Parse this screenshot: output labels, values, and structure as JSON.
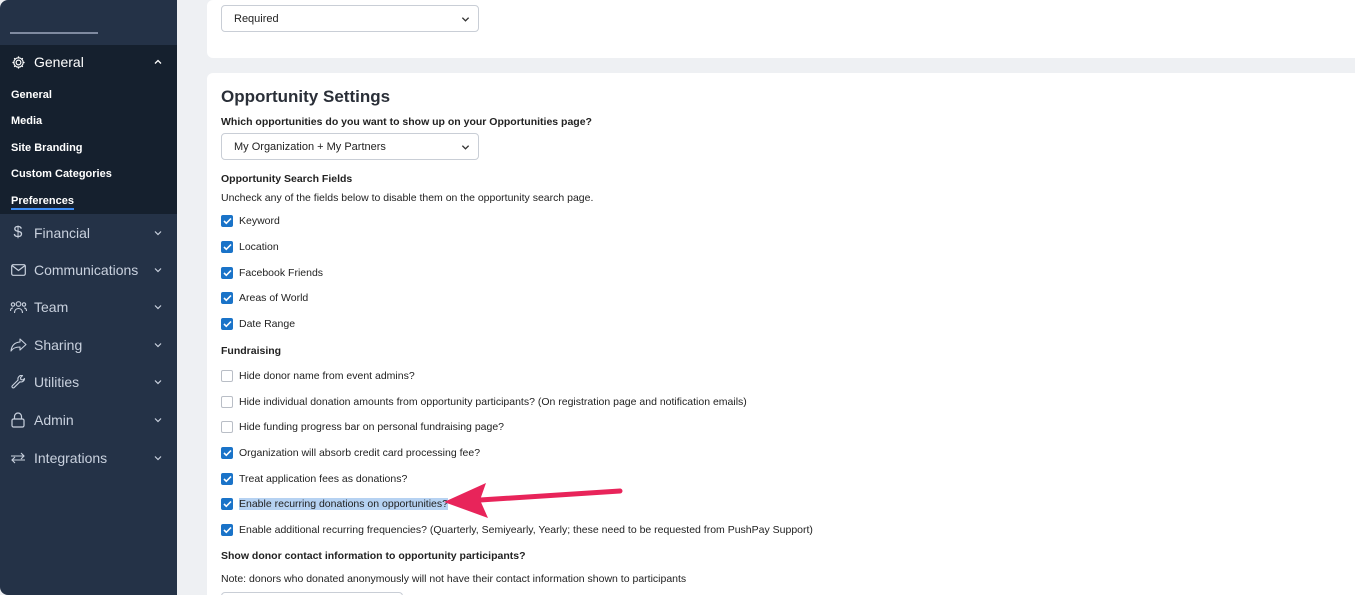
{
  "sidebar": {
    "general_header": "General",
    "general_items": [
      "General",
      "Media",
      "Site Branding",
      "Custom Categories",
      "Preferences"
    ],
    "nav": [
      {
        "label": "Financial",
        "icon": "dollar-icon"
      },
      {
        "label": "Communications",
        "icon": "mail-icon"
      },
      {
        "label": "Team",
        "icon": "team-icon"
      },
      {
        "label": "Sharing",
        "icon": "share-icon"
      },
      {
        "label": "Utilities",
        "icon": "wrench-icon"
      },
      {
        "label": "Admin",
        "icon": "lock-icon"
      },
      {
        "label": "Integrations",
        "icon": "arrows-icon"
      }
    ]
  },
  "top_panel": {
    "select_value": "Required"
  },
  "opportunity": {
    "title": "Opportunity Settings",
    "question": "Which opportunities do you want to show up on your Opportunities page?",
    "select_value": "My Organization + My Partners",
    "search_fields_title": "Opportunity Search Fields",
    "search_fields_desc": "Uncheck any of the fields below to disable them on the opportunity search page.",
    "search_fields": [
      {
        "label": "Keyword",
        "checked": true
      },
      {
        "label": "Location",
        "checked": true
      },
      {
        "label": "Facebook Friends",
        "checked": true
      },
      {
        "label": "Areas of World",
        "checked": true
      },
      {
        "label": "Date Range",
        "checked": true
      }
    ],
    "fundraising_title": "Fundraising",
    "fundraising": [
      {
        "label": "Hide donor name from event admins?",
        "checked": false
      },
      {
        "label": "Hide individual donation amounts from opportunity participants? (On registration page and notification emails)",
        "checked": false
      },
      {
        "label": "Hide funding progress bar on personal fundraising page?",
        "checked": false
      },
      {
        "label": "Organization will absorb credit card processing fee?",
        "checked": true
      },
      {
        "label": "Treat application fees as donations?",
        "checked": true
      },
      {
        "label": "Enable recurring donations on opportunities?",
        "checked": true
      },
      {
        "label": "Enable additional recurring frequencies? (Quarterly, Semiyearly, Yearly; these need to be requested from PushPay Support)",
        "checked": true
      }
    ],
    "donor_info_title": "Show donor contact information to opportunity participants?",
    "donor_info_note": "Note: donors who donated anonymously will not have their contact information shown to participants"
  },
  "colors": {
    "sidebar": "#243247",
    "sidebar_active": "#15202e",
    "accent": "#1a73c8",
    "arrow": "#e8245a",
    "highlight": "#b6d2f2"
  }
}
